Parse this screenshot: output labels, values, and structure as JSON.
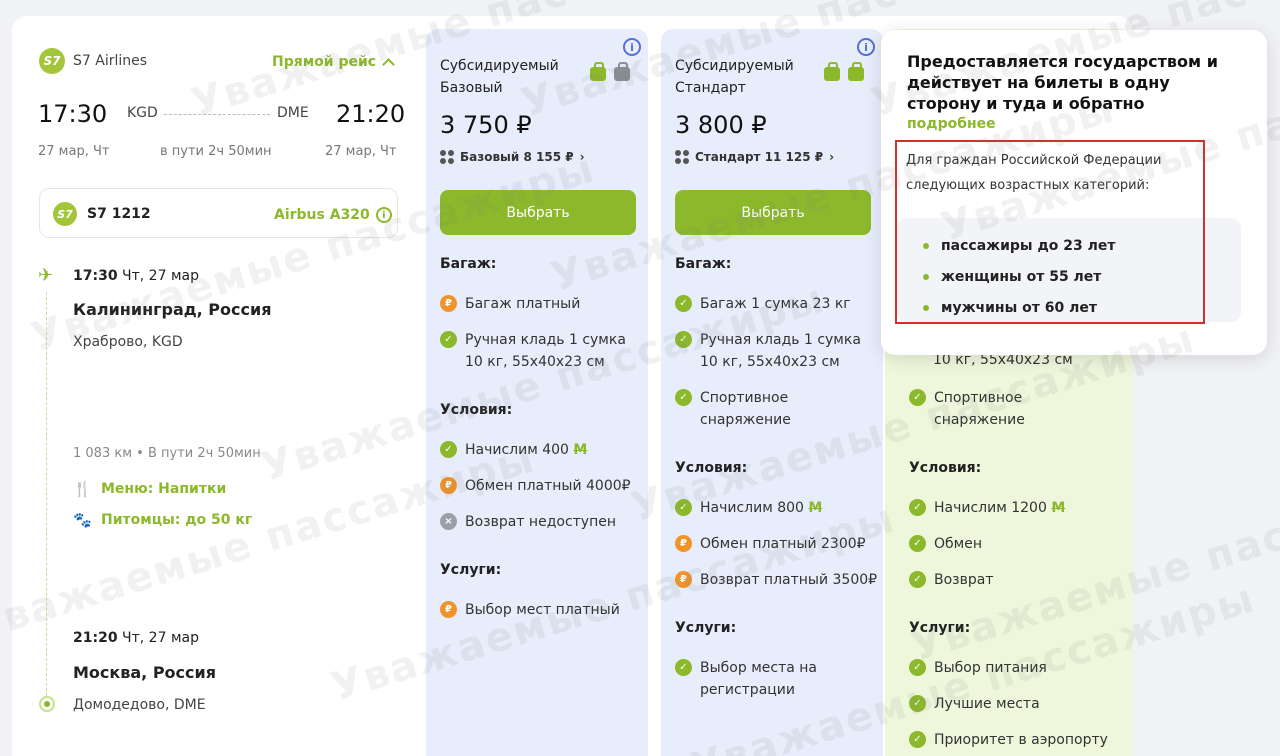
{
  "flight": {
    "airline": "S7 Airlines",
    "logo": "S7",
    "direct": "Прямой рейс",
    "dep_time": "17:30",
    "dep_code": "KGD",
    "arr_code": "DME",
    "arr_time": "21:20",
    "dep_date": "27 мар, Чт",
    "duration": "в пути 2ч 50мин",
    "arr_date": "27 мар, Чт",
    "flight_no": "S7 1212",
    "aircraft": "Airbus A320",
    "seg_dep_time": "17:30",
    "seg_dep_day": "Чт, 27 мар",
    "seg_dep_city": "Калининград, Россия",
    "seg_dep_airport": "Храброво, KGD",
    "distance": "1 083 км",
    "seg_duration": "В пути 2ч 50мин",
    "menu": "Меню: Напитки",
    "pets": "Питомцы: до 50 кг",
    "seg_arr_time": "21:20",
    "seg_arr_day": "Чт, 27 мар",
    "seg_arr_city": "Москва, Россия",
    "seg_arr_airport": "Домодедово, DME"
  },
  "fares": {
    "base": {
      "name": "Субсидируемый Базовый",
      "price": "3 750 ₽",
      "sub": "Базовый 8 155 ₽",
      "button": "Выбрать",
      "baggage_title": "Багаж:",
      "baggage": [
        "Багаж платный",
        "Ручная кладь 1 сумка 10 кг, 55х40х23 см"
      ],
      "conditions_title": "Условия:",
      "conditions": [
        "Начислим 400",
        "Обмен платный 4000₽",
        "Возврат недоступен"
      ],
      "services_title": "Услуги:",
      "services": [
        "Выбор мест платный"
      ]
    },
    "standard": {
      "name": "Субсидируемый Стандарт",
      "price": "3 800 ₽",
      "sub": "Стандарт 11 125 ₽",
      "button": "Выбрать",
      "baggage_title": "Багаж:",
      "baggage": [
        "Багаж 1 сумка 23 кг",
        "Ручная кладь 1 сумка 10 кг, 55х40х23 см",
        "Спортивное снаряжение"
      ],
      "conditions_title": "Условия:",
      "conditions": [
        "Начислим 800",
        "Обмен платный 2300₽",
        "Возврат платный 3500₽"
      ],
      "services_title": "Услуги:",
      "services": [
        "Выбор места на регистрации"
      ]
    },
    "plus": {
      "baggage_tail": "10 кг, 55х40х23 см",
      "sport": "Спортивное снаряжение",
      "conditions_title": "Условия:",
      "conditions": [
        "Начислим 1200",
        "Обмен",
        "Возврат"
      ],
      "services_title": "Услуги:",
      "services": [
        "Выбор питания",
        "Лучшие места",
        "Приоритет в аэропорту"
      ]
    },
    "miles_symbol": "M"
  },
  "popup": {
    "title": "Предоставляется государством и действует на билеты в одну сторону и туда и обратно",
    "more": "подробнее",
    "desc": "Для граждан Российской Федерации следующих возрастных категорий:",
    "items": [
      "пассажиры до 23 лет",
      "женщины от 55 лет",
      "мужчины от 60 лет"
    ]
  },
  "watermark": "Уважаемые пассажиры",
  "colors": {
    "accent": "#8cb82b",
    "fare_bg": "#e7edfb",
    "paid": "#f0932b",
    "highlight": "#d32f2f"
  }
}
